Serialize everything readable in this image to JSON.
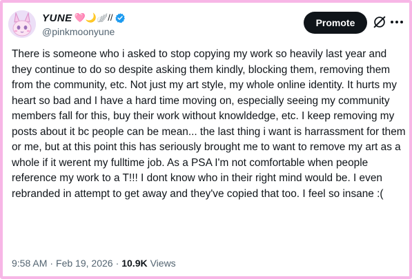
{
  "author": {
    "display_name": "YUNE",
    "decorations": "🩷🌙🪽//",
    "handle": "@pinkmoonyune",
    "verified_icon": "verified-badge-icon",
    "avatar_icon": "avatar-bunny-icon"
  },
  "actions": {
    "promote_label": "Promote",
    "grok_icon": "grok-icon",
    "more_icon": "more-dots-icon"
  },
  "post": {
    "text": "There is someone who i asked to stop copying my work so heavily last year and they continue to do so despite asking them kindly, blocking them, removing them from the community, etc.  Not just my art style, my whole online identity. It hurts my heart so bad and I have a hard time moving on, especially seeing my community members fall for this, buy their work without knowldedge, etc. I keep removing my posts about it bc people can be mean... the last thing i want is harrassment for them or me, but at this point this has seriously brought me to want to remove my art as a whole if it werent my fulltime job.  As a PSA I'm not comfortable when people reference my work to a T!!! I dont know who in their right mind would be.  I even rebranded in attempt to get away and they've copied that too. I feel so insane :("
  },
  "meta": {
    "time": "9:58 AM",
    "separator": "·",
    "date": "Feb 19, 2026",
    "views_count": "10.9K",
    "views_label": "Views"
  },
  "colors": {
    "border": "#f7b6e6",
    "verified": "#1d9bf0",
    "text": "#0f1419",
    "secondary": "#536471"
  }
}
